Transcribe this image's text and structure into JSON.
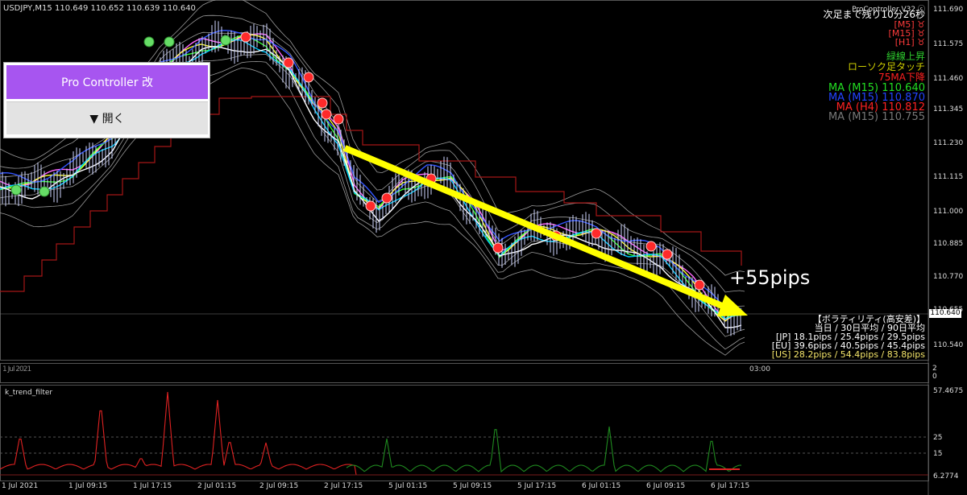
{
  "chart": {
    "symbol": "USDJPY,M15",
    "ohlc": "110.649 110.652 110.639 110.640",
    "current_price": "110.640",
    "price_ticks": [
      "111.690",
      "111.575",
      "111.460",
      "111.345",
      "111.230",
      "111.115",
      "111.000",
      "110.885",
      "110.770",
      "110.655",
      "110.540"
    ],
    "time_ticks": [
      "1 Jul 2021",
      "1 Jul 09:15",
      "1 Jul 17:15",
      "2 Jul 01:15",
      "2 Jul 09:15",
      "2 Jul 17:15",
      "5 Jul 01:15",
      "5 Jul 09:15",
      "5 Jul 17:15",
      "6 Jul 01:15",
      "6 Jul 09:15",
      "6 Jul 17:15"
    ],
    "overlap_time_text": "03:00",
    "colors": {
      "bg": "#000000",
      "grid": "#404040",
      "red_line": "#b01414",
      "yellow_arrow": "#ffff00"
    }
  },
  "pro_controller": {
    "title": "Pro Controller 改",
    "open_label": "▼ 開く",
    "version": "ProController V32 ⓒ",
    "countdown": "次足まで残り10分26秒",
    "timeframes": [
      {
        "label": "[M5]",
        "icon": "♉",
        "color": "#ff3b3b"
      },
      {
        "label": "[M15]",
        "icon": "♉",
        "color": "#ff3b3b"
      },
      {
        "label": "[H1]",
        "icon": "♉",
        "color": "#ff3b3b"
      }
    ],
    "signals": [
      {
        "text": "緑線上昇",
        "color": "#2ecc2e"
      },
      {
        "text": "ローソク足タッチ",
        "color": "#cccc00"
      },
      {
        "text": "75MA下降",
        "color": "#ff2020"
      }
    ],
    "ma_lines": [
      {
        "text": "MA (M15) 110.640",
        "color": "#22dd22"
      },
      {
        "text": "MA (M15) 110.870",
        "color": "#2244ff"
      },
      {
        "text": "MA (H4) 110.812",
        "color": "#ff2222"
      },
      {
        "text": "MA (M15) 110.755",
        "color": "#777777"
      }
    ]
  },
  "annotation": {
    "pips_text": "+55pips"
  },
  "volatility": {
    "title": "【ボラティリティ(高安差)】",
    "header": "当日 / 30日平均 / 90日平均",
    "rows": [
      {
        "text": "[JP] 18.1pips / 25.4pips / 29.5pips",
        "color": "#ffffff"
      },
      {
        "text": "[EU] 39.6pips / 40.5pips / 45.4pips",
        "color": "#ffffff"
      },
      {
        "text": "[US] 28.2pips / 54.4pips / 83.8pips",
        "color": "#f5e66b"
      }
    ]
  },
  "indicator": {
    "name": "k_trend_filter",
    "ticks": [
      "57.4675",
      "25",
      "15",
      "6.2774"
    ],
    "sep_ticks": [
      "2",
      "0"
    ]
  }
}
